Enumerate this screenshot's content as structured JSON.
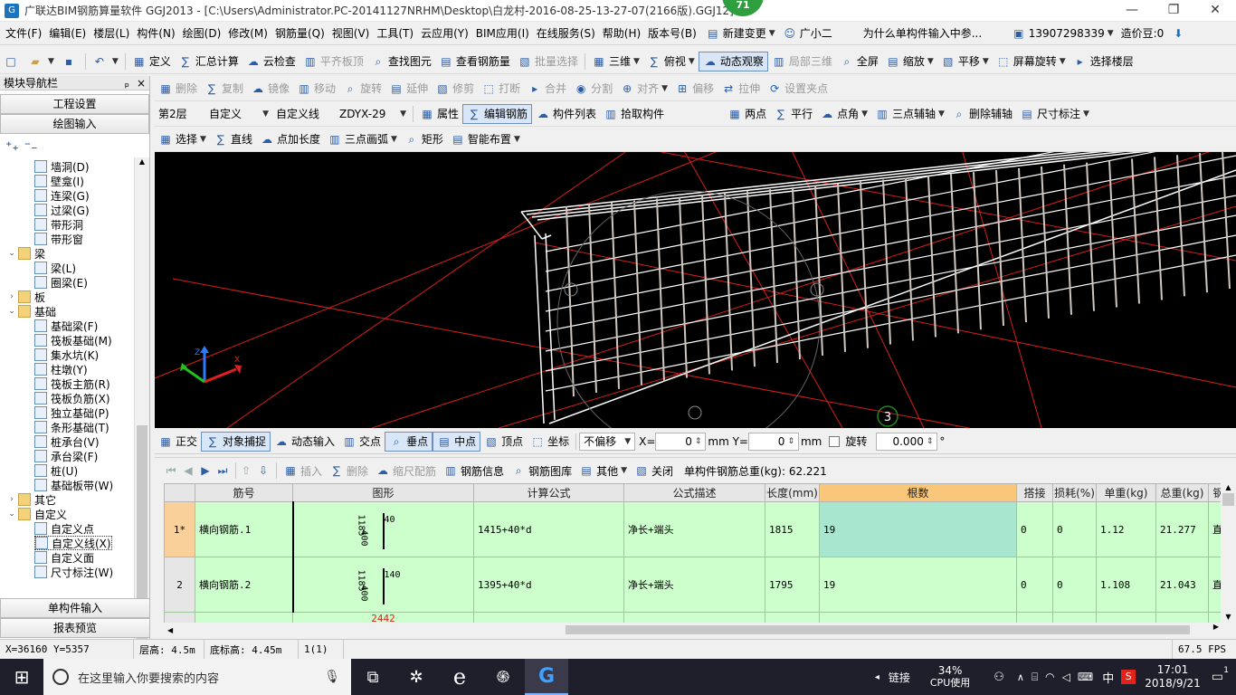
{
  "titlebar": {
    "title": "广联达BIM钢筋算量软件 GGJ2013 - [C:\\Users\\Administrator.PC-20141127NRHM\\Desktop\\白龙村-2016-08-25-13-27-07(2166版).GGJ12]",
    "badge": "71",
    "minimize": "—",
    "restore": "❐",
    "close": "✕"
  },
  "menu": {
    "items": [
      "文件(F)",
      "编辑(E)",
      "楼层(L)",
      "构件(N)",
      "绘图(D)",
      "修改(M)",
      "钢筋量(Q)",
      "视图(V)",
      "工具(T)",
      "云应用(Y)",
      "BIM应用(I)",
      "在线服务(S)",
      "帮助(H)",
      "版本号(B)"
    ],
    "new_change": "新建变更",
    "xiaoer": "广小二",
    "question": "为什么单构件输入中参...",
    "phone": "13907298339",
    "price_bean": "造价豆:0"
  },
  "toolbar1": {
    "items": [
      "定义",
      "汇总计算",
      "云检查",
      "平齐板顶",
      "查找图元",
      "查看钢筋量",
      "批量选择"
    ],
    "view_items": [
      "三维",
      "俯视",
      "动态观察",
      "局部三维",
      "全屏",
      "缩放",
      "平移",
      "屏幕旋转",
      "选择楼层"
    ]
  },
  "toolbar2": {
    "items": [
      "删除",
      "复制",
      "镜像",
      "移动",
      "旋转",
      "延伸",
      "修剪",
      "打断",
      "合并",
      "分割",
      "对齐",
      "偏移",
      "拉伸",
      "设置夹点"
    ]
  },
  "toolbar3": {
    "floor": "第2层",
    "category": "自定义",
    "type": "自定义线",
    "component": "ZDYX-29",
    "items": [
      "属性",
      "编辑钢筋",
      "构件列表",
      "拾取构件"
    ],
    "axis_items": [
      "两点",
      "平行",
      "点角",
      "三点辅轴",
      "删除辅轴",
      "尺寸标注"
    ]
  },
  "toolbar4": {
    "items": [
      "选择",
      "直线",
      "点加长度",
      "三点画弧",
      "矩形",
      "智能布置"
    ]
  },
  "nav": {
    "header": "模块导航栏",
    "pin": "ₚ",
    "close": "×",
    "engineering": "工程设置",
    "drawing_input": "绘图输入",
    "single_input": "单构件输入",
    "report_preview": "报表预览",
    "tree": [
      {
        "label": "墙洞(D)",
        "level": 2,
        "folder": false
      },
      {
        "label": "壁龛(I)",
        "level": 2,
        "folder": false
      },
      {
        "label": "连梁(G)",
        "level": 2,
        "folder": false
      },
      {
        "label": "过梁(G)",
        "level": 2,
        "folder": false
      },
      {
        "label": "带形洞",
        "level": 2,
        "folder": false
      },
      {
        "label": "带形窗",
        "level": 2,
        "folder": false
      },
      {
        "label": "梁",
        "level": 1,
        "folder": true,
        "open": true
      },
      {
        "label": "梁(L)",
        "level": 2,
        "folder": false
      },
      {
        "label": "圈梁(E)",
        "level": 2,
        "folder": false
      },
      {
        "label": "板",
        "level": 1,
        "folder": true,
        "open": false
      },
      {
        "label": "基础",
        "level": 1,
        "folder": true,
        "open": true
      },
      {
        "label": "基础梁(F)",
        "level": 2,
        "folder": false
      },
      {
        "label": "筏板基础(M)",
        "level": 2,
        "folder": false
      },
      {
        "label": "集水坑(K)",
        "level": 2,
        "folder": false
      },
      {
        "label": "柱墩(Y)",
        "level": 2,
        "folder": false
      },
      {
        "label": "筏板主筋(R)",
        "level": 2,
        "folder": false
      },
      {
        "label": "筏板负筋(X)",
        "level": 2,
        "folder": false
      },
      {
        "label": "独立基础(P)",
        "level": 2,
        "folder": false
      },
      {
        "label": "条形基础(T)",
        "level": 2,
        "folder": false
      },
      {
        "label": "桩承台(V)",
        "level": 2,
        "folder": false
      },
      {
        "label": "承台梁(F)",
        "level": 2,
        "folder": false
      },
      {
        "label": "桩(U)",
        "level": 2,
        "folder": false
      },
      {
        "label": "基础板带(W)",
        "level": 2,
        "folder": false
      },
      {
        "label": "其它",
        "level": 1,
        "folder": true,
        "open": false
      },
      {
        "label": "自定义",
        "level": 1,
        "folder": true,
        "open": true
      },
      {
        "label": "自定义点",
        "level": 2,
        "folder": false
      },
      {
        "label": "自定义线(X)",
        "level": 2,
        "folder": false,
        "selected": true
      },
      {
        "label": "自定义面",
        "level": 2,
        "folder": false
      },
      {
        "label": "尺寸标注(W)",
        "level": 2,
        "folder": false
      }
    ]
  },
  "viewport": {
    "axis_label": "3"
  },
  "snapbar": {
    "items": [
      "正交",
      "对象捕捉",
      "动态输入",
      "交点",
      "垂点",
      "中点",
      "顶点",
      "坐标"
    ],
    "offset": "不偏移",
    "x_label": "X=",
    "x_value": "0",
    "y_label": "mm Y=",
    "y_value": "0",
    "mm": "mm",
    "rotate": "旋转",
    "rotate_value": "0.000",
    "deg": "°"
  },
  "rebar_toolbar": {
    "items": [
      "插入",
      "删除",
      "缩尺配筋",
      "钢筋信息",
      "钢筋图库",
      "其他",
      "关闭"
    ],
    "total_label": "单构件钢筋总重(kg): 62.221"
  },
  "table": {
    "headers": [
      "",
      "筋号",
      "图形",
      "计算公式",
      "公式描述",
      "长度(mm)",
      "根数",
      "搭接",
      "损耗(%)",
      "单重(kg)",
      "总重(kg)",
      "钢筋归"
    ],
    "rows": [
      {
        "idx": "1*",
        "name": "横向钢筋.1",
        "shape_a": "1185",
        "shape_b": "400",
        "shape_c": "40",
        "formula": "1415+40*d",
        "desc": "净长+端头",
        "length": "1815",
        "count": "19",
        "lap": "0",
        "loss": "0",
        "unit": "1.12",
        "total": "21.277",
        "type": "直筋"
      },
      {
        "idx": "2",
        "name": "横向钢筋.2",
        "shape_a": "1185",
        "shape_b": "400",
        "shape_c": "140",
        "formula": "1395+40*d",
        "desc": "净长+端头",
        "length": "1795",
        "count": "19",
        "lap": "0",
        "loss": "0",
        "unit": "1.108",
        "total": "21.043",
        "type": "直筋"
      }
    ],
    "partial_shape": "2442"
  },
  "status": {
    "coords": "X=36160 Y=5357",
    "floor_height": "层高: 4.5m",
    "base_height": "底标高: 4.45m",
    "count": "1(1)",
    "fps": "67.5 FPS"
  },
  "taskbar": {
    "search_placeholder": "在这里输入你要搜索的内容",
    "link": "链接",
    "cpu_percent": "34%",
    "cpu_label": "CPU使用",
    "lang": "中",
    "time": "17:01",
    "date": "2018/9/21",
    "notif": "1"
  }
}
